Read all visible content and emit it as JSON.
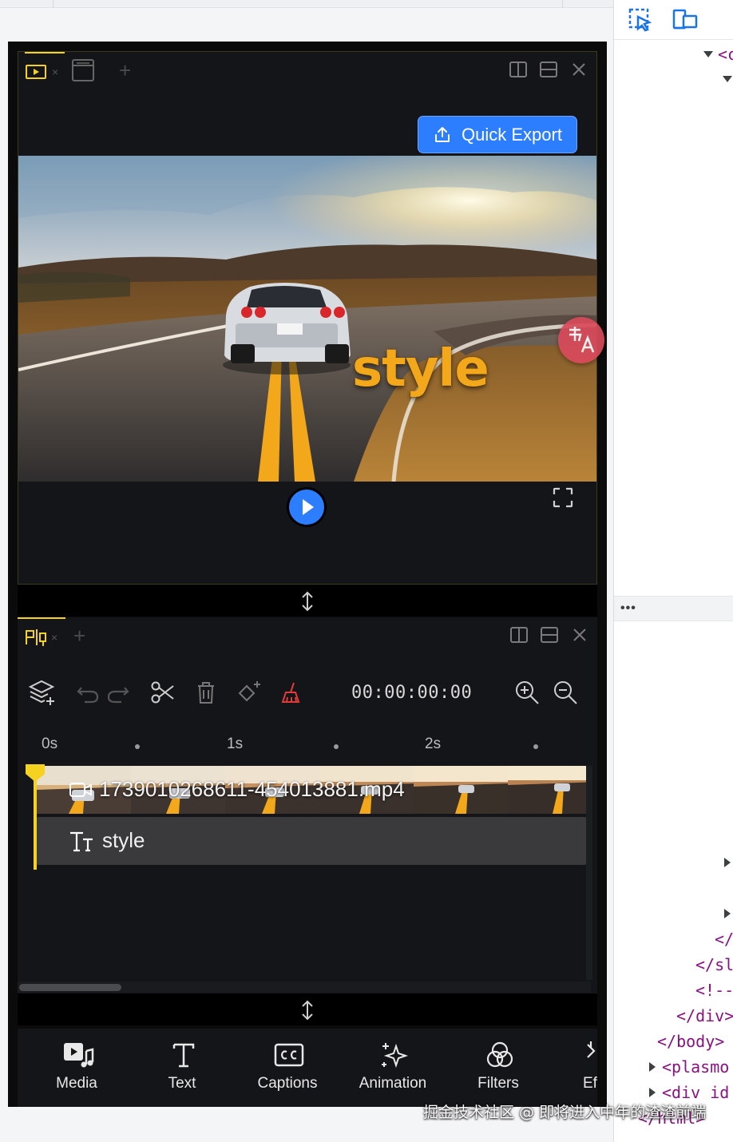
{
  "preview": {
    "export_label": "Quick Export",
    "overlay_text": "style"
  },
  "timeline": {
    "timecode": "00:00:00:00",
    "ruler_ticks": [
      "0s",
      "1s",
      "2s"
    ],
    "video_clip_name": "1739010268611-454013881.mp4",
    "text_clip_name": "style"
  },
  "bottom_nav": {
    "items": [
      {
        "label": "Media",
        "icon": "media-icon"
      },
      {
        "label": "Text",
        "icon": "text-icon"
      },
      {
        "label": "Captions",
        "icon": "captions-icon"
      },
      {
        "label": "Animation",
        "icon": "animation-icon"
      },
      {
        "label": "Filters",
        "icon": "filters-icon"
      },
      {
        "label": "Ef",
        "icon": "effects-icon"
      }
    ]
  },
  "devtools": {
    "dots": "•••",
    "lines": [
      "<c",
      "</",
      "</sl",
      "<!--",
      "</div>",
      "</body>",
      "<plasmo",
      "<div id",
      "</html>"
    ]
  },
  "watermark": "掘金技术社区 @ 即将进入中年的渣渣前端",
  "colors": {
    "accent_blue": "#2d7dff",
    "accent_yellow": "#f4d21f",
    "caption_orange": "#f2a81a",
    "panel_bg": "#141518"
  }
}
